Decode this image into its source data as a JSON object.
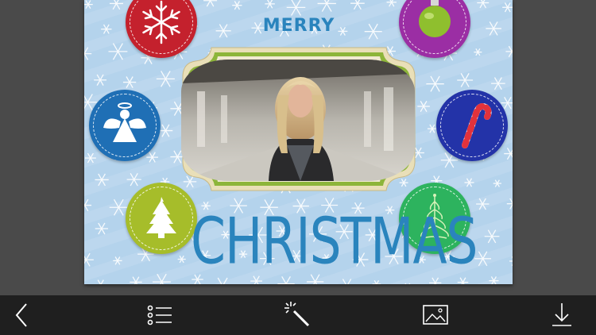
{
  "card": {
    "title_top": "MERRY",
    "title_bottom": "CHRISTMAS",
    "background_color": "#b4d3ec",
    "text_color": "#2a84bd",
    "ornaments": [
      {
        "name": "snowflake-icon",
        "color": "#c4212d"
      },
      {
        "name": "christmas-ball-icon",
        "color": "#9b2ea4"
      },
      {
        "name": "angel-icon",
        "color": "#1f6fb5"
      },
      {
        "name": "candy-cane-icon",
        "color": "#2333a8"
      },
      {
        "name": "christmas-tree-icon",
        "color": "#a6bd2a"
      },
      {
        "name": "ornate-tree-icon",
        "color": "#2db35e"
      }
    ]
  },
  "toolbar": {
    "items": [
      {
        "name": "back-icon"
      },
      {
        "name": "list-icon"
      },
      {
        "name": "magic-wand-icon"
      },
      {
        "name": "image-icon"
      },
      {
        "name": "download-icon"
      }
    ]
  }
}
